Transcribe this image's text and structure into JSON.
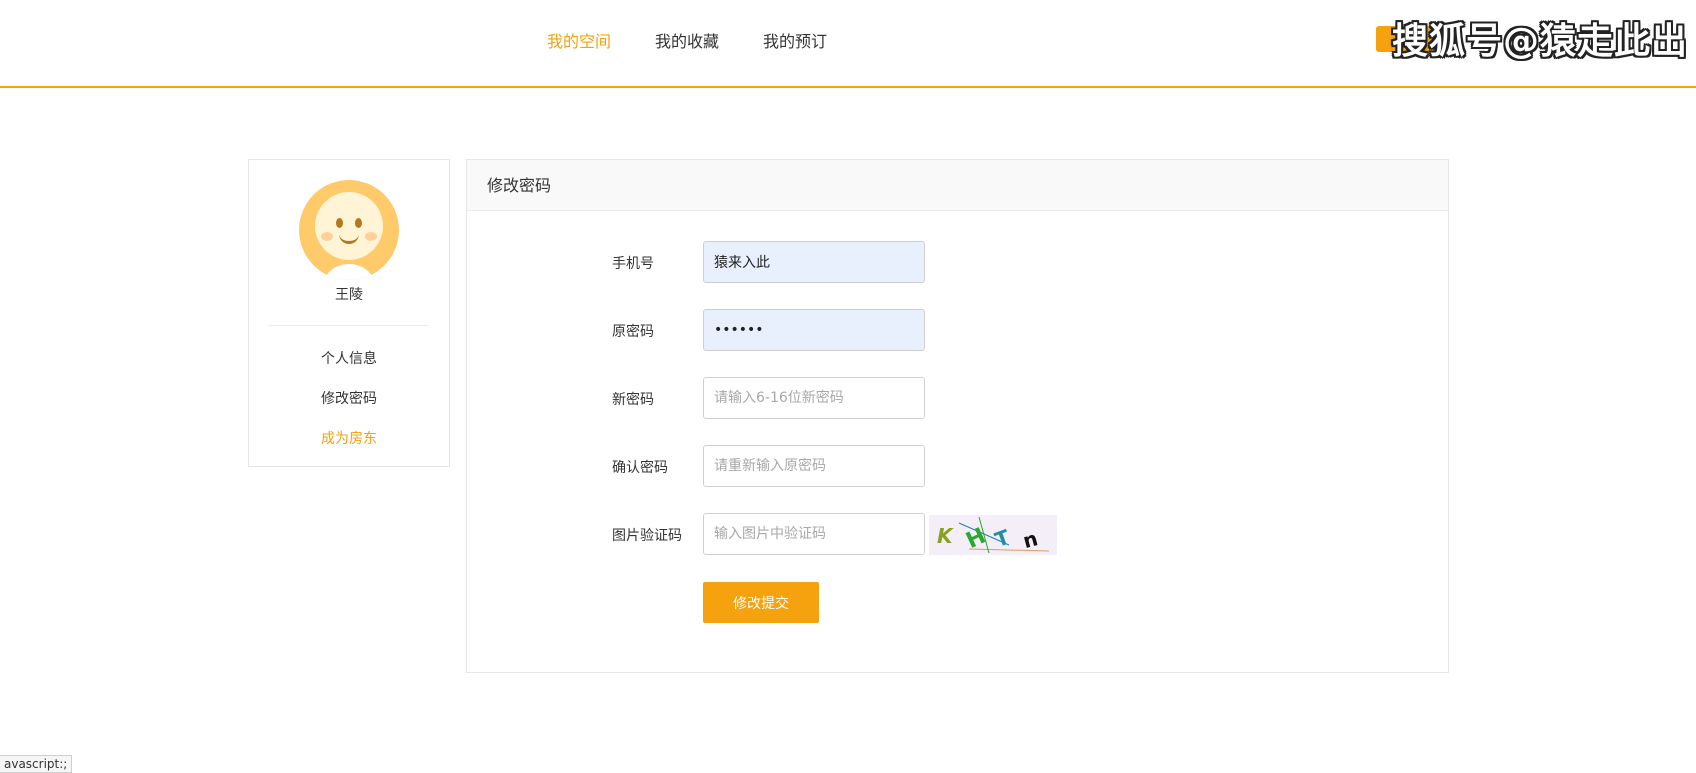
{
  "header": {
    "nav": [
      {
        "label": "我的空间",
        "active": true
      },
      {
        "label": "我的收藏",
        "active": false
      },
      {
        "label": "我的预订",
        "active": false
      }
    ],
    "watermark": "搜狐号@猿走此出",
    "accent_color": "#f5a20e"
  },
  "sidebar": {
    "avatar_icon": "smiley-avatar-icon",
    "username": "王陵",
    "menu": [
      {
        "label": "个人信息"
      },
      {
        "label": "修改密码"
      },
      {
        "label": "成为房东"
      }
    ]
  },
  "form": {
    "title": "修改密码",
    "fields": [
      {
        "label": "手机号",
        "value": "猿来入此",
        "placeholder": ""
      },
      {
        "label": "原密码",
        "value": "••••••",
        "placeholder": ""
      },
      {
        "label": "新密码",
        "value": "",
        "placeholder": "请输入6-16位新密码"
      },
      {
        "label": "确认密码",
        "value": "",
        "placeholder": "请重新输入原密码"
      },
      {
        "label": "图片验证码",
        "value": "",
        "placeholder": "输入图片中验证码"
      }
    ],
    "captcha_text": [
      "K",
      "H",
      "T",
      "n"
    ],
    "submit_label": "修改提交"
  },
  "status_bar": {
    "text": "avascript:;"
  }
}
